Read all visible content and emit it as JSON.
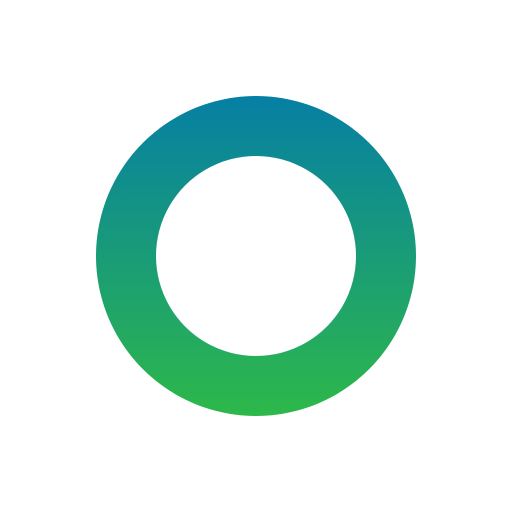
{
  "logo": {
    "icon": "ring-logo-icon",
    "gradient_top_color": "#067FA4",
    "gradient_bottom_color": "#2DB84A",
    "inner_color": "#FFFFFF",
    "background_color": "#FFFFFF"
  }
}
